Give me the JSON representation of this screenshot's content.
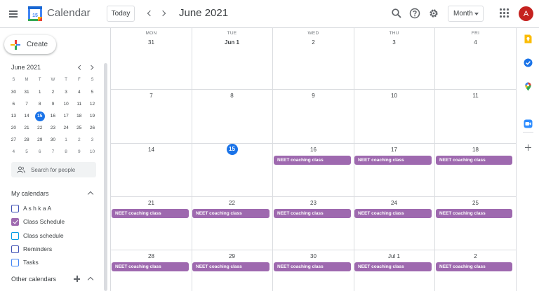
{
  "header": {
    "app_title": "Calendar",
    "logo_day": "15",
    "today_label": "Today",
    "month_title": "June 2021",
    "view_select": "Month",
    "avatar_initial": "A"
  },
  "sidebar": {
    "create_label": "Create",
    "mini_calendar": {
      "title": "June 2021",
      "weekday_heads": [
        "S",
        "M",
        "T",
        "W",
        "T",
        "F",
        "S"
      ],
      "weeks": [
        [
          "30",
          "31",
          "1",
          "2",
          "3",
          "4",
          "5"
        ],
        [
          "6",
          "7",
          "8",
          "9",
          "10",
          "11",
          "12"
        ],
        [
          "13",
          "14",
          "15",
          "16",
          "17",
          "18",
          "19"
        ],
        [
          "20",
          "21",
          "22",
          "23",
          "24",
          "25",
          "26"
        ],
        [
          "27",
          "28",
          "29",
          "30",
          "1",
          "2",
          "3"
        ],
        [
          "4",
          "5",
          "6",
          "7",
          "8",
          "9",
          "10"
        ]
      ]
    },
    "search_placeholder": "Search for people",
    "my_calendars_title": "My calendars",
    "calendars": [
      {
        "label": "A s h k a A",
        "checked": false,
        "color": "#3f51b5"
      },
      {
        "label": "Class Schedule",
        "checked": true,
        "color": "#9e69af"
      },
      {
        "label": "Class schedule",
        "checked": false,
        "color": "#039be5"
      },
      {
        "label": "Reminders",
        "checked": false,
        "color": "#3f51b5"
      },
      {
        "label": "Tasks",
        "checked": false,
        "color": "#4285f4"
      }
    ],
    "other_calendars_title": "Other calendars"
  },
  "grid": {
    "weekdays": [
      "MON",
      "TUE",
      "WED",
      "THU",
      "FRI"
    ],
    "weeks": [
      [
        "31",
        "Jun 1",
        "2",
        "3",
        "4"
      ],
      [
        "7",
        "8",
        "9",
        "10",
        "11"
      ],
      [
        "14",
        "15",
        "16",
        "17",
        "18"
      ],
      [
        "21",
        "22",
        "23",
        "24",
        "25"
      ],
      [
        "28",
        "29",
        "30",
        "Jul 1",
        "2"
      ]
    ],
    "event_label": "NEET coaching class",
    "event_color": "#9e69af",
    "today_color": "#1a73e8"
  }
}
